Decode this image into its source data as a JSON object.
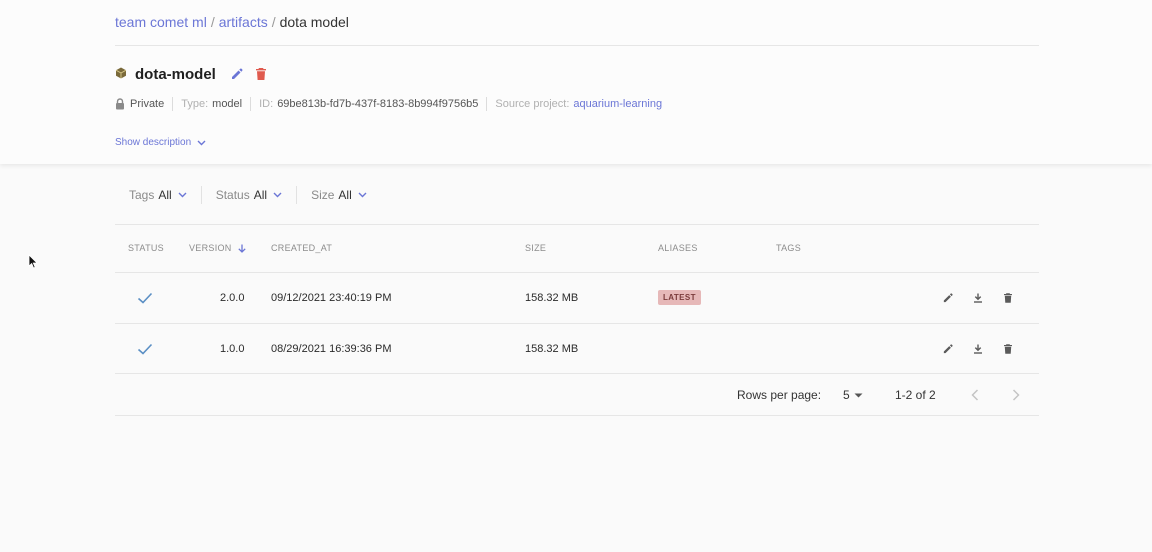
{
  "breadcrumb": {
    "team": "team comet ml",
    "section": "artifacts",
    "current": "dota model",
    "separator": "/"
  },
  "artifact": {
    "icon": "package-icon",
    "name": "dota-model",
    "visibility": "Private",
    "type_label": "Type:",
    "type_value": "model",
    "id_label": "ID:",
    "id_value": "69be813b-fd7b-437f-8183-8b994f9756b5",
    "source_label": "Source project:",
    "source_value": "aquarium-learning",
    "show_description": "Show description"
  },
  "filters": [
    {
      "label": "Tags",
      "value": "All"
    },
    {
      "label": "Status",
      "value": "All"
    },
    {
      "label": "Size",
      "value": "All"
    }
  ],
  "table": {
    "columns": {
      "status": "STATUS",
      "version": "VERSION",
      "created_at": "CREATED_AT",
      "size": "SIZE",
      "aliases": "ALIASES",
      "tags": "TAGS"
    },
    "rows": [
      {
        "status": "check-icon",
        "version": "2.0.0",
        "created_at": "09/12/2021 23:40:19 PM",
        "size": "158.32 MB",
        "alias": "LATEST"
      },
      {
        "status": "check-icon",
        "version": "1.0.0",
        "created_at": "08/29/2021 16:39:36 PM",
        "size": "158.32 MB",
        "alias": ""
      }
    ]
  },
  "pagination": {
    "rows_per_page_label": "Rows per page:",
    "rows_per_page": "5",
    "range": "1-2 of 2"
  },
  "colors": {
    "accent": "#6b76d6",
    "delete": "#e05a4e",
    "check": "#5b8fc4",
    "badge_bg": "#e6b8b8"
  }
}
